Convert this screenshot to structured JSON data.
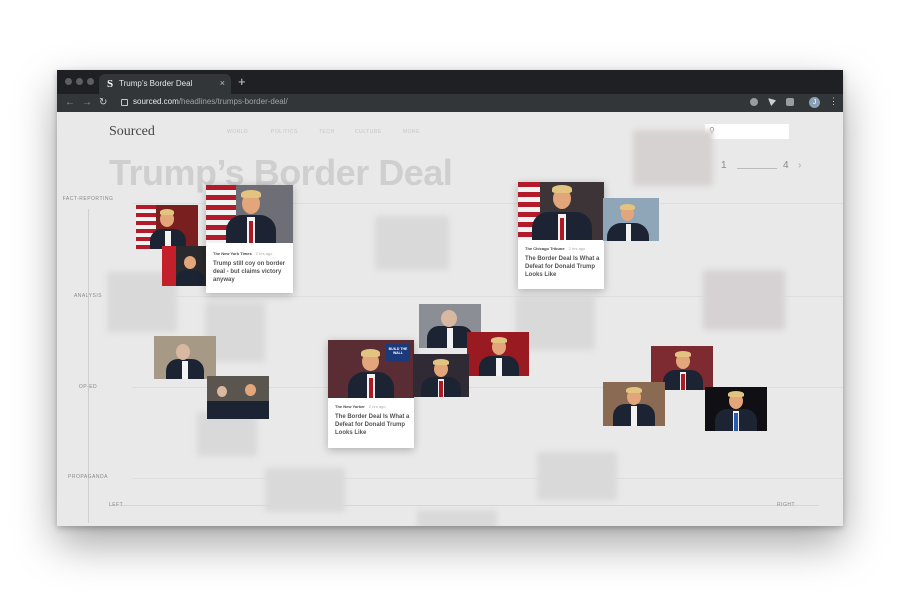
{
  "browser": {
    "tab_title": "Trump’s Border Deal",
    "tab_favicon": "S",
    "tab_close": "×",
    "new_tab": "+",
    "url_domain": "sourced.com",
    "url_path": "/headlines/trumps-border-deal/",
    "avatar_letter": "J",
    "icons": [
      "back-icon",
      "forward-icon",
      "reload-icon",
      "lock-icon",
      "menu-icon"
    ]
  },
  "site": {
    "logo": "Sourced",
    "nav": [
      "WORLD",
      "POLITICS",
      "TECH",
      "CULTURE",
      "MORE"
    ],
    "headline": "Trump’s Border Deal",
    "pager": {
      "current": "1",
      "total": "4",
      "prev": "‹",
      "next": "›"
    }
  },
  "axis": {
    "y_labels": [
      "FACT-REPORTING",
      "ANALYSIS",
      "OP-ED",
      "PROPAGANDA"
    ],
    "x_left": "LEFT",
    "x_right": "RIGHT"
  },
  "cards": [
    {
      "source": "The New York Times",
      "time": "2 hrs ago",
      "title": "Trump still coy on border deal - but claims victory anyway"
    },
    {
      "source": "The Chicago Tribune",
      "time": "2 hrs ago",
      "title": "The Border Deal Is What a Defeat for Donald Trump Looks Like"
    },
    {
      "source": "The New Yorker",
      "time": "2 hrs ago",
      "title": "The Border Deal Is What a Defeat for Donald Trump Looks Like"
    }
  ],
  "sign_text": "BUILD THE WALL",
  "colors": {
    "background": "#e9e9e9",
    "titlebar": "#1f2023",
    "headline": "#cfcfcf",
    "suit": "#1c2433",
    "tie": "#b01822"
  }
}
